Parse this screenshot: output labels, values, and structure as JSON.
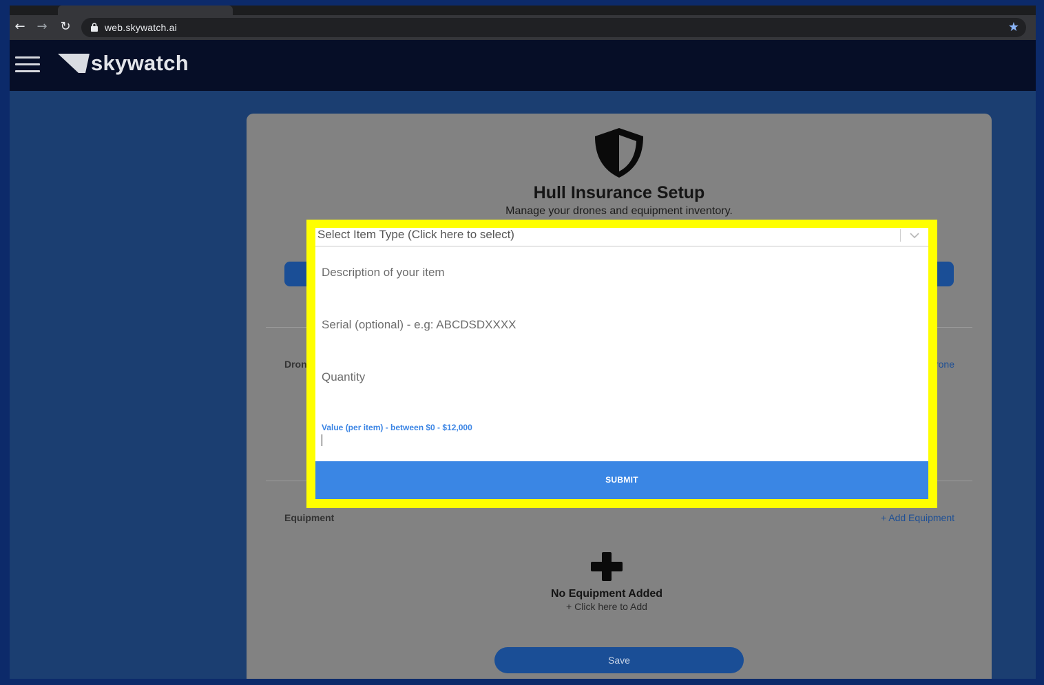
{
  "browser": {
    "url": "web.skywatch.ai",
    "back_glyph": "←",
    "forward_glyph": "→",
    "reload_glyph": "↻",
    "bookmark_glyph": "★"
  },
  "app": {
    "brand": "skywatch"
  },
  "card": {
    "title": "Hull Insurance Setup",
    "subtitle": "Manage your drones and equipment inventory.",
    "drones_label": "Drones",
    "drones_link": "+ Add Drone",
    "equipment_label": "Equipment",
    "equipment_link": "+ Add Equipment",
    "empty_title": "No Equipment Added",
    "empty_sub": "+ Click here to Add",
    "save_label": "Save"
  },
  "modal": {
    "select_placeholder": "Select Item Type (Click here to select)",
    "description_placeholder": "Description of your item",
    "serial_placeholder": "Serial (optional) - e.g: ABCDSDXXXX",
    "quantity_placeholder": "Quantity",
    "value_label": "Value (per item) - between $0 - $12,000",
    "value": "",
    "submit_label": "SUBMIT"
  },
  "colors": {
    "highlight": "#ffff00",
    "submit": "#3a86e4",
    "primary_dark_blue": "#1a4e96",
    "page_blue": "#1b3e71",
    "header_navy": "#060e27"
  }
}
